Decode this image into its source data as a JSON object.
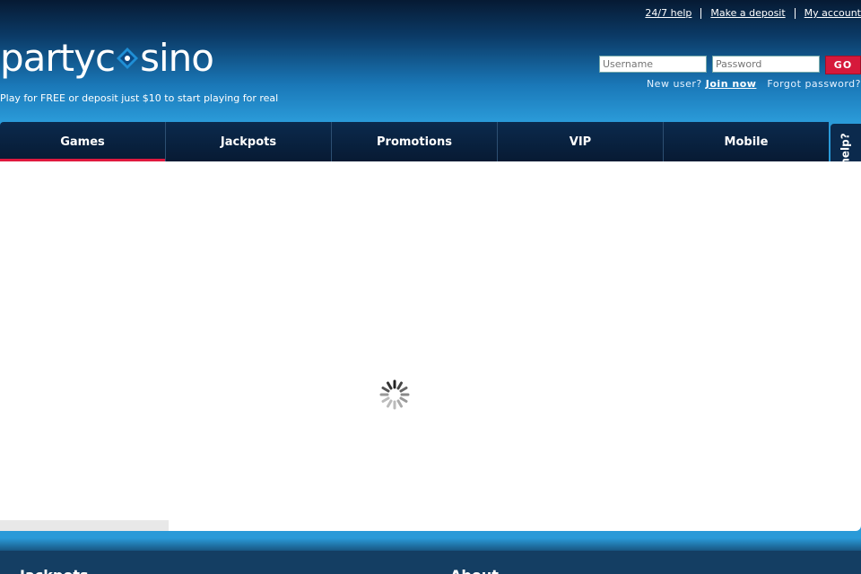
{
  "top_links": [
    "24/7 help",
    "Make a deposit",
    "My account"
  ],
  "logo": {
    "text_left": "partyc",
    "text_right": "sino"
  },
  "tagline": "Play for FREE or deposit just $10 to start playing for real",
  "login": {
    "username_placeholder": "Username",
    "password_placeholder": "Password",
    "go_label": "GO",
    "new_user_text": "New user?",
    "join_label": "Join now",
    "forgot_label": "Forgot password?"
  },
  "nav": {
    "tabs": [
      "Games",
      "Jackpots",
      "Promotions",
      "VIP",
      "Mobile"
    ],
    "active": "Games"
  },
  "need_help": "Need help?",
  "footer": {
    "left_heading": "Jackpots",
    "right_heading": "About"
  },
  "colors": {
    "accent_red": "#d6193b",
    "nav_bg": "#0b2a4d",
    "page_blue": "#2a9ad8"
  },
  "icons": {
    "logo_chip": "casino-chip-icon",
    "loading": "loading-spinner-icon"
  }
}
